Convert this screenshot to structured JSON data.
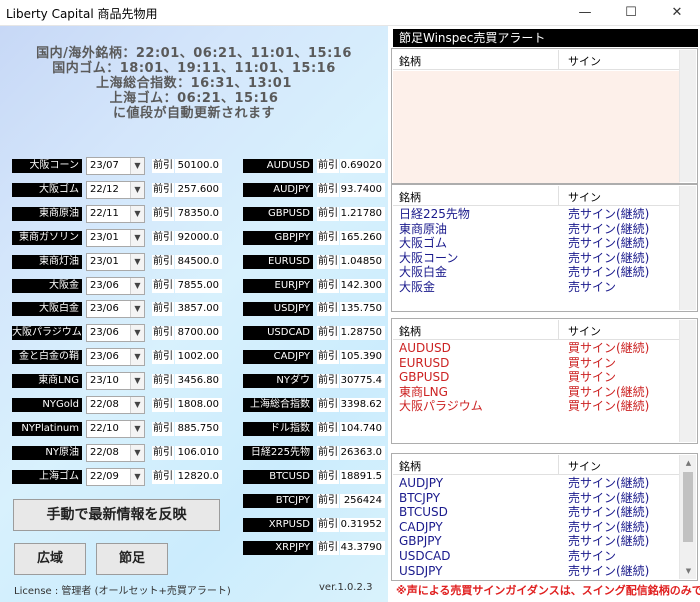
{
  "window": {
    "title": "Liberty Capital 商品先物用",
    "minimize": "—",
    "maximize": "☐",
    "close": "✕"
  },
  "info": {
    "line1": "国内/海外銘柄：22:01、06:21、11:01、15:16",
    "line2": "国内ゴム：18:01、19:11、11:01、15:16",
    "line3": "上海総合指数：16:31、13:01",
    "line4": "上海ゴム：06:21、15:16",
    "line5": "に値段が自動更新されます"
  },
  "zenhiki_label": "前引",
  "commodities": [
    {
      "name": "大阪コーン",
      "month": "23/07",
      "value": "50100.0"
    },
    {
      "name": "大阪ゴム",
      "month": "22/12",
      "value": "257.600"
    },
    {
      "name": "東商原油",
      "month": "22/11",
      "value": "78350.0"
    },
    {
      "name": "東商ガソリン",
      "month": "23/01",
      "value": "92000.0"
    },
    {
      "name": "東商灯油",
      "month": "23/01",
      "value": "84500.0"
    },
    {
      "name": "大阪金",
      "month": "23/06",
      "value": "7855.00"
    },
    {
      "name": "大阪白金",
      "month": "23/06",
      "value": "3857.00"
    },
    {
      "name": "大阪パラジウム",
      "month": "23/06",
      "value": "8700.00"
    },
    {
      "name": "金と白金の鞘",
      "month": "23/06",
      "value": "1002.00"
    },
    {
      "name": "東商LNG",
      "month": "23/10",
      "value": "3456.80"
    },
    {
      "name": "NYGold",
      "month": "22/08",
      "value": "1808.00"
    },
    {
      "name": "NYPlatinum",
      "month": "22/10",
      "value": "885.750"
    },
    {
      "name": "NY原油",
      "month": "22/08",
      "value": "106.010"
    },
    {
      "name": "上海ゴム",
      "month": "22/09",
      "value": "12820.0"
    }
  ],
  "fx": [
    {
      "name": "AUDUSD",
      "value": "0.69020"
    },
    {
      "name": "AUDJPY",
      "value": "93.7400"
    },
    {
      "name": "GBPUSD",
      "value": "1.21780"
    },
    {
      "name": "GBPJPY",
      "value": "165.260"
    },
    {
      "name": "EURUSD",
      "value": "1.04850"
    },
    {
      "name": "EURJPY",
      "value": "142.300"
    },
    {
      "name": "USDJPY",
      "value": "135.750"
    },
    {
      "name": "USDCAD",
      "value": "1.28750"
    },
    {
      "name": "CADJPY",
      "value": "105.390"
    },
    {
      "name": "NYダウ",
      "value": "30775.4"
    },
    {
      "name": "上海総合指数",
      "value": "3398.62"
    },
    {
      "name": "ドル指数",
      "value": "104.740"
    },
    {
      "name": "日経225先物",
      "value": "26363.0"
    },
    {
      "name": "BTCUSD",
      "value": "18891.5"
    },
    {
      "name": "BTCJPY",
      "value": "256424"
    },
    {
      "name": "XRPUSD",
      "value": "0.31952"
    },
    {
      "name": "XRPJPY",
      "value": "43.3790"
    }
  ],
  "buttons": {
    "refresh": "手動で最新情報を反映",
    "wide": "広域",
    "ashi": "節足"
  },
  "license": "License : 管理者 (オールセット+売買アラート)",
  "version": "ver.1.0.2.3",
  "alert_header": "節足Winspec売買アラート",
  "col_name": "銘柄",
  "col_sign": "サイン",
  "panel_sell": [
    {
      "name": "日経225先物",
      "sign": "売サイン(継続)"
    },
    {
      "name": "東商原油",
      "sign": "売サイン(継続)"
    },
    {
      "name": "大阪ゴム",
      "sign": "売サイン(継続)"
    },
    {
      "name": "大阪コーン",
      "sign": "売サイン(継続)"
    },
    {
      "name": "大阪白金",
      "sign": "売サイン(継続)"
    },
    {
      "name": "大阪金",
      "sign": "売サイン"
    }
  ],
  "panel_buy": [
    {
      "name": "AUDUSD",
      "sign": "買サイン(継続)"
    },
    {
      "name": "EURUSD",
      "sign": "買サイン"
    },
    {
      "name": "GBPUSD",
      "sign": "買サイン"
    },
    {
      "name": "東商LNG",
      "sign": "買サイン(継続)"
    },
    {
      "name": "大阪パラジウム",
      "sign": "買サイン(継続)"
    }
  ],
  "panel_fx": [
    {
      "name": "AUDJPY",
      "sign": "売サイン(継続)"
    },
    {
      "name": "BTCJPY",
      "sign": "売サイン(継続)"
    },
    {
      "name": "BTCUSD",
      "sign": "売サイン(継続)"
    },
    {
      "name": "CADJPY",
      "sign": "売サイン(継続)"
    },
    {
      "name": "GBPJPY",
      "sign": "売サイン(継続)"
    },
    {
      "name": "USDCAD",
      "sign": "売サイン"
    },
    {
      "name": "USDJPY",
      "sign": "売サイン(継続)"
    }
  ],
  "notice": "※声による売買サインガイダンスは、スイング配信銘柄のみです",
  "colors": {
    "sell": "#1a1a8c",
    "buy": "#cc2222",
    "alert_empty_bg": "#fdf0ea"
  }
}
